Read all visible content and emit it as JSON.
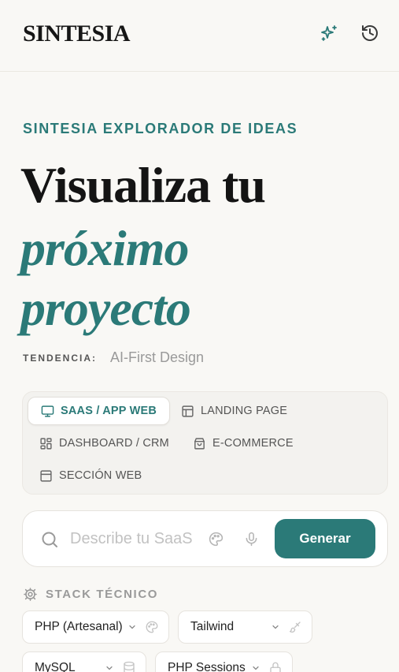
{
  "header": {
    "logo": "SINTESIA",
    "icons": {
      "sparkles": "sparkles-icon",
      "history": "history-icon"
    }
  },
  "hero": {
    "eyebrow": "SINTESIA EXPLORADOR DE IDEAS",
    "title_line1": "Visualiza tu",
    "title_line2": "próximo",
    "title_line3": "proyecto",
    "trend_label": "TENDENCIA:",
    "trend_value": "AI-First Design"
  },
  "project_types": [
    {
      "label": "SAAS / APP WEB",
      "icon": "monitor-icon",
      "active": true
    },
    {
      "label": "LANDING PAGE",
      "icon": "layout-icon",
      "active": false
    },
    {
      "label": "DASHBOARD / CRM",
      "icon": "dashboard-icon",
      "active": false
    },
    {
      "label": "E-COMMERCE",
      "icon": "shopping-bag-icon",
      "active": false
    },
    {
      "label": "SECCIÓN WEB",
      "icon": "section-icon",
      "active": false
    }
  ],
  "search": {
    "placeholder": "Describe tu SaaS",
    "value": "",
    "button_label": "Generar"
  },
  "stack": {
    "label": "STACK TÉCNICO",
    "chips": [
      {
        "label": "PHP (Artesanal)",
        "icon": "palette-icon"
      },
      {
        "label": "Tailwind",
        "icon": "brush-icon"
      },
      {
        "label": "MySQL",
        "icon": "database-icon"
      },
      {
        "label": "PHP Sessions",
        "icon": "lock-icon"
      }
    ]
  },
  "colors": {
    "accent": "#2b7a78",
    "background": "#f9f8f5"
  }
}
